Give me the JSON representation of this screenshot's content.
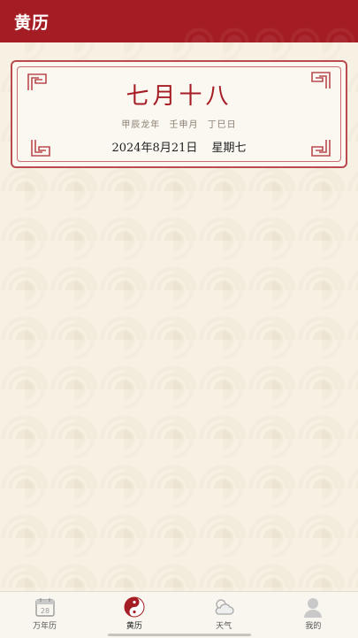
{
  "appbar": {
    "title": "黄历"
  },
  "calendar_card": {
    "lunar_date": "七月十八",
    "ganzhi": {
      "year": "甲辰龙年",
      "month": "壬申月",
      "day": "丁巳日"
    },
    "solar_date": "2024年8月21日",
    "weekday": "星期七"
  },
  "tabbar": {
    "items": [
      {
        "label": "万年历",
        "icon": "calendar-icon",
        "badge": "28",
        "active": false
      },
      {
        "label": "黄历",
        "icon": "yinyang-icon",
        "active": true
      },
      {
        "label": "天气",
        "icon": "weather-icon",
        "active": false
      },
      {
        "label": "我的",
        "icon": "profile-icon",
        "active": false
      }
    ]
  },
  "colors": {
    "brand_red": "#a51d24",
    "background": "#f7f1e4",
    "card_border": "#b94a4f"
  }
}
